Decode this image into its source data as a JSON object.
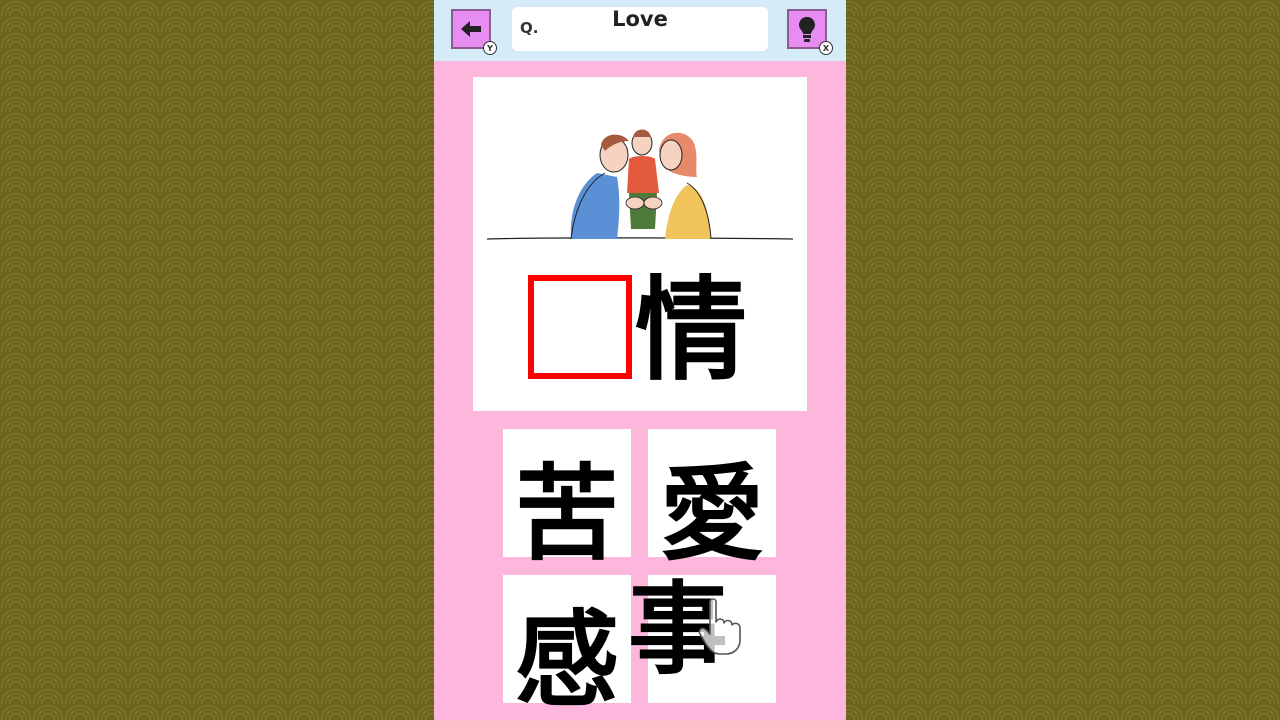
{
  "header": {
    "back_button_hint": "Y",
    "hint_button_hint": "X",
    "question_label": "Q.",
    "question_word": "Love"
  },
  "puzzle": {
    "illustration": "family-hug-illustration",
    "known_kanji": "情",
    "blank_color": "#ff0000"
  },
  "choices": [
    "苦",
    "愛",
    "感",
    "事"
  ],
  "dragged_tile": "事",
  "icons": [
    "back-arrow-icon",
    "lightbulb-icon",
    "pointing-hand-icon"
  ],
  "colors": {
    "panel_background": "#fdb7dd",
    "header_background": "#d5ecf8",
    "button_fill": "#e78cf0",
    "outer_background": "#6b6420"
  }
}
